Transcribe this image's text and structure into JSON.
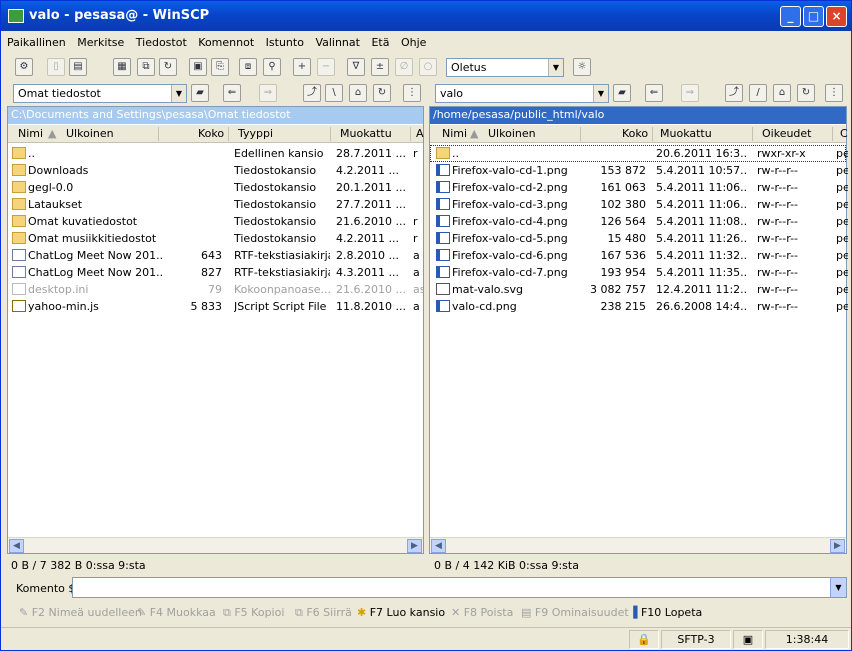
{
  "window": {
    "title": "valo - pesasa@            - WinSCP"
  },
  "menu": [
    "Paikallinen",
    "Merkitse",
    "Tiedostot",
    "Komennot",
    "Istunto",
    "Valinnat",
    "Etä",
    "Ohje"
  ],
  "toolbar": {
    "preset": "Oletus"
  },
  "left": {
    "location": "Omat tiedostot",
    "path": "C:\\Documents and Settings\\pesasa\\Omat tiedostot",
    "columns": {
      "name": "Nimi",
      "ext": "Ulkoinen",
      "size": "Koko",
      "type": "Tyyppi",
      "modified": "Muokattu",
      "attr": "A"
    },
    "rows": [
      {
        "icon": "up-folder-icon",
        "name": "..",
        "size": "",
        "type": "Edellinen kansio",
        "modified": "28.7.2011 ...",
        "attr": "r"
      },
      {
        "icon": "folder-icon",
        "name": "Downloads",
        "size": "",
        "type": "Tiedostokansio",
        "modified": "4.2.2011 ...",
        "attr": ""
      },
      {
        "icon": "folder-icon",
        "name": "gegl-0.0",
        "size": "",
        "type": "Tiedostokansio",
        "modified": "20.1.2011 ...",
        "attr": ""
      },
      {
        "icon": "folder-icon",
        "name": "Lataukset",
        "size": "",
        "type": "Tiedostokansio",
        "modified": "27.7.2011 ...",
        "attr": ""
      },
      {
        "icon": "folder-icon",
        "name": "Omat kuvatiedostot",
        "size": "",
        "type": "Tiedostokansio",
        "modified": "21.6.2010 ...",
        "attr": "r"
      },
      {
        "icon": "folder-icon",
        "name": "Omat musiikkitiedostot",
        "size": "",
        "type": "Tiedostokansio",
        "modified": "4.2.2011 ...",
        "attr": "r"
      },
      {
        "icon": "file-icon",
        "name": "ChatLog Meet Now 201...",
        "size": "643",
        "type": "RTF-tekstiasiakirja",
        "modified": "2.8.2010 ...",
        "attr": "a"
      },
      {
        "icon": "file-icon",
        "name": "ChatLog Meet Now 201...",
        "size": "827",
        "type": "RTF-tekstiasiakirja",
        "modified": "4.3.2011 ...",
        "attr": "a"
      },
      {
        "icon": "ini-icon",
        "name": "desktop.ini",
        "size": "79",
        "type": "Kokoonpanoase...",
        "modified": "21.6.2010 ...",
        "attr": "as",
        "ghost": true
      },
      {
        "icon": "js-icon",
        "name": "yahoo-min.js",
        "size": "5 833",
        "type": "JScript Script File",
        "modified": "11.8.2010 ...",
        "attr": "a"
      }
    ],
    "status": "0 B / 7 382 B 0:ssa 9:sta"
  },
  "right": {
    "location": "valo",
    "path": "/home/pesasa/public_html/valo",
    "columns": {
      "name": "Nimi",
      "ext": "Ulkoinen",
      "size": "Koko",
      "modified": "Muokattu",
      "rights": "Oikeudet",
      "owner": "C"
    },
    "rows": [
      {
        "icon": "up-folder-icon",
        "name": "..",
        "size": "",
        "modified": "20.6.2011 16:3...",
        "rights": "rwxr-xr-x",
        "owner": "pe"
      },
      {
        "icon": "png-icon",
        "name": "Firefox-valo-cd-1.png",
        "size": "153 872",
        "modified": "5.4.2011 10:57...",
        "rights": "rw-r--r--",
        "owner": "pe"
      },
      {
        "icon": "png-icon",
        "name": "Firefox-valo-cd-2.png",
        "size": "161 063",
        "modified": "5.4.2011 11:06...",
        "rights": "rw-r--r--",
        "owner": "pe"
      },
      {
        "icon": "png-icon",
        "name": "Firefox-valo-cd-3.png",
        "size": "102 380",
        "modified": "5.4.2011 11:06...",
        "rights": "rw-r--r--",
        "owner": "pe"
      },
      {
        "icon": "png-icon",
        "name": "Firefox-valo-cd-4.png",
        "size": "126 564",
        "modified": "5.4.2011 11:08...",
        "rights": "rw-r--r--",
        "owner": "pe"
      },
      {
        "icon": "png-icon",
        "name": "Firefox-valo-cd-5.png",
        "size": "15 480",
        "modified": "5.4.2011 11:26...",
        "rights": "rw-r--r--",
        "owner": "pe"
      },
      {
        "icon": "png-icon",
        "name": "Firefox-valo-cd-6.png",
        "size": "167 536",
        "modified": "5.4.2011 11:32...",
        "rights": "rw-r--r--",
        "owner": "pe"
      },
      {
        "icon": "png-icon",
        "name": "Firefox-valo-cd-7.png",
        "size": "193 954",
        "modified": "5.4.2011 11:35...",
        "rights": "rw-r--r--",
        "owner": "pe"
      },
      {
        "icon": "svg-icon",
        "name": "mat-valo.svg",
        "size": "3 082 757",
        "modified": "12.4.2011 11:2...",
        "rights": "rw-r--r--",
        "owner": "pe"
      },
      {
        "icon": "png-icon",
        "name": "valo-cd.png",
        "size": "238 215",
        "modified": "26.6.2008 14:4...",
        "rights": "rw-r--r--",
        "owner": "pe"
      }
    ],
    "status": "0 B / 4 142 KiB 0:ssa 9:sta"
  },
  "command": {
    "label": "Komento $",
    "value": ""
  },
  "fkeys": [
    {
      "label": "F2 Nimeä uudelleen",
      "enabled": false
    },
    {
      "label": "F4 Muokkaa",
      "enabled": false
    },
    {
      "label": "F5 Kopioi",
      "enabled": false
    },
    {
      "label": "F6 Siirrä",
      "enabled": false
    },
    {
      "label": "F7 Luo kansio",
      "enabled": true
    },
    {
      "label": "F8 Poista",
      "enabled": false
    },
    {
      "label": "F9 Ominaisuudet",
      "enabled": false
    },
    {
      "label": "F10 Lopeta",
      "enabled": true
    }
  ],
  "statusbar": {
    "protocol": "SFTP-3",
    "time": "1:38:44"
  }
}
